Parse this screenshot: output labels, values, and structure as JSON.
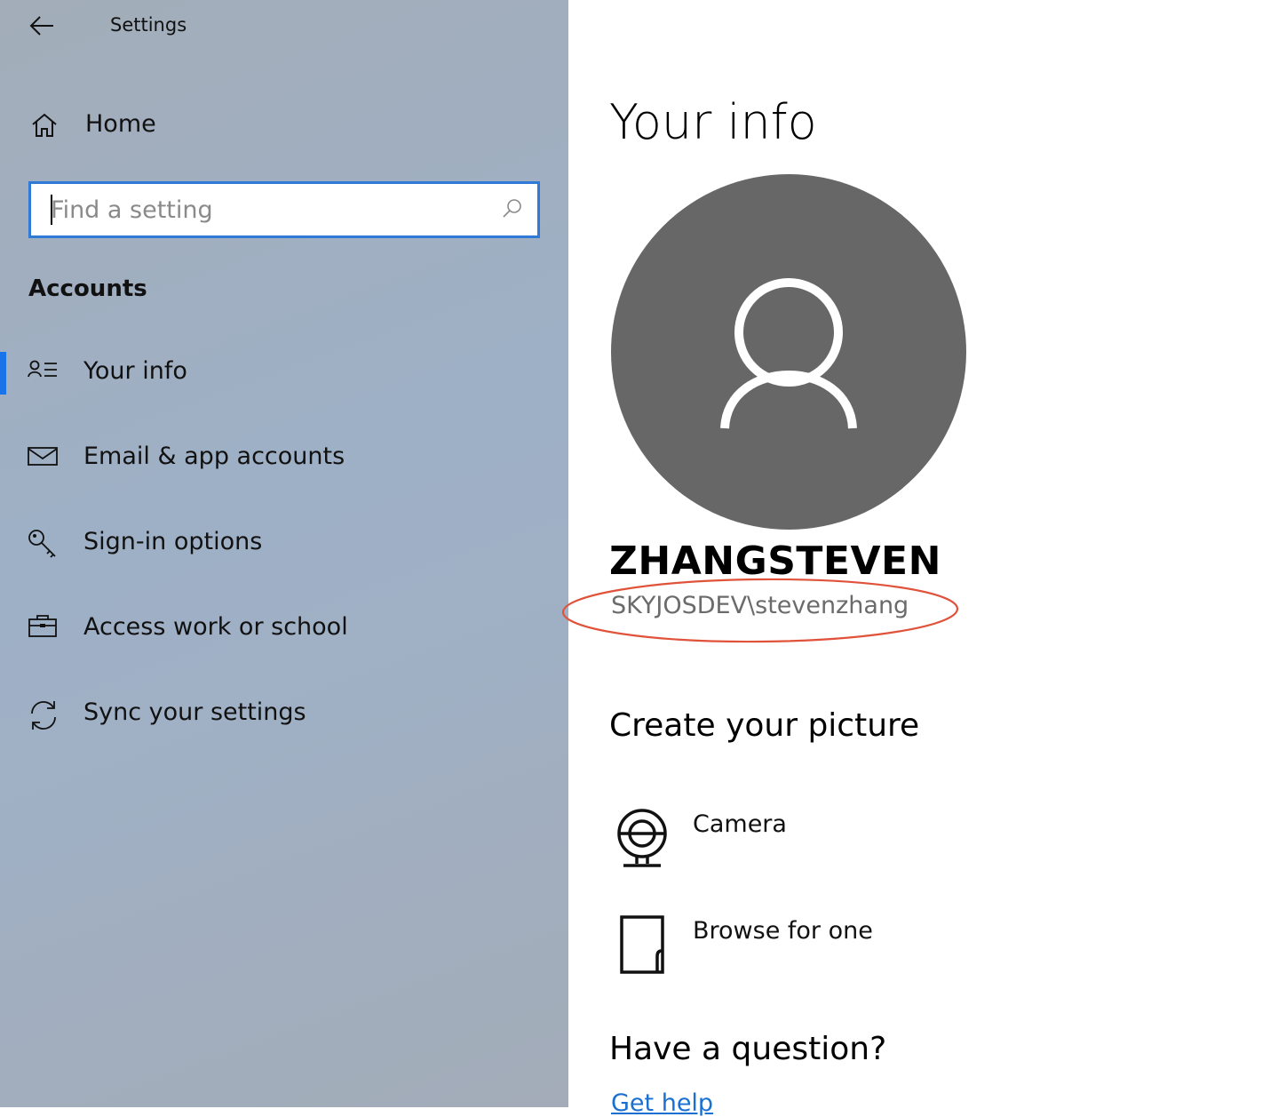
{
  "window": {
    "title": "Settings"
  },
  "sidebar": {
    "home_label": "Home",
    "search": {
      "placeholder": "Find a setting",
      "value": ""
    },
    "section_title": "Accounts",
    "items": [
      {
        "label": "Your info",
        "icon": "contact-list-icon",
        "active": true
      },
      {
        "label": "Email & app accounts",
        "icon": "mail-icon",
        "active": false
      },
      {
        "label": "Sign-in options",
        "icon": "key-icon",
        "active": false
      },
      {
        "label": "Access work or school",
        "icon": "briefcase-icon",
        "active": false
      },
      {
        "label": "Sync your settings",
        "icon": "sync-icon",
        "active": false
      }
    ]
  },
  "main": {
    "title": "Your info",
    "user": {
      "name": "ZHANGSTEVEN",
      "account": "SKYJOSDEV\\stevenzhang"
    },
    "create_picture": {
      "heading": "Create your picture",
      "options": [
        {
          "label": "Camera",
          "icon": "webcam-icon"
        },
        {
          "label": "Browse for one",
          "icon": "browse-file-icon"
        }
      ]
    },
    "question": {
      "heading": "Have a question?",
      "link": "Get help"
    }
  },
  "colors": {
    "accent": "#1a73e8",
    "search_border": "#2f7ad6",
    "avatar_bg": "#676767",
    "annotation": "#e0533a",
    "link": "#1a6fd1"
  }
}
